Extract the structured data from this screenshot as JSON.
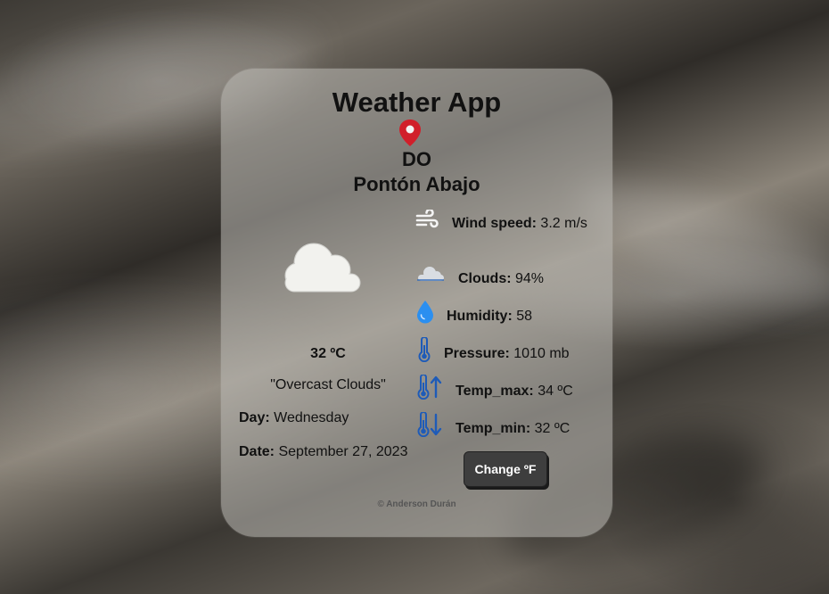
{
  "app": {
    "title": "Weather App"
  },
  "location": {
    "country": "DO",
    "city": "Pontón Abajo",
    "pin_icon": "map-pin-icon",
    "pin_color": "#d11f2a"
  },
  "current": {
    "temperature": "32 ºC",
    "description": "\"Overcast Clouds\"",
    "weather_icon": "cloud-icon",
    "day_label": "Day:",
    "day_value": "Wednesday",
    "date_label": "Date:",
    "date_value": "September 27, 2023"
  },
  "stats": [
    {
      "icon": "wind-icon",
      "label": "Wind speed:",
      "value": "3.2 m/s"
    },
    {
      "icon": "clouds-icon",
      "label": "Clouds:",
      "value": "94%"
    },
    {
      "icon": "droplet-icon",
      "label": "Humidity:",
      "value": "58"
    },
    {
      "icon": "thermometer-icon",
      "label": "Pressure:",
      "value": "1010 mb"
    },
    {
      "icon": "thermometer-up-icon",
      "label": "Temp_max:",
      "value": "34 ºC"
    },
    {
      "icon": "thermometer-down-icon",
      "label": "Temp_min:",
      "value": "32 ºC"
    }
  ],
  "actions": {
    "change_unit_label": "Change ºF"
  },
  "footer": {
    "credit": "© Anderson Durán"
  },
  "colors": {
    "accent_blue": "#1e5bb8",
    "droplet_blue": "#2b8ff0",
    "button_bg": "#3e3e3e"
  }
}
